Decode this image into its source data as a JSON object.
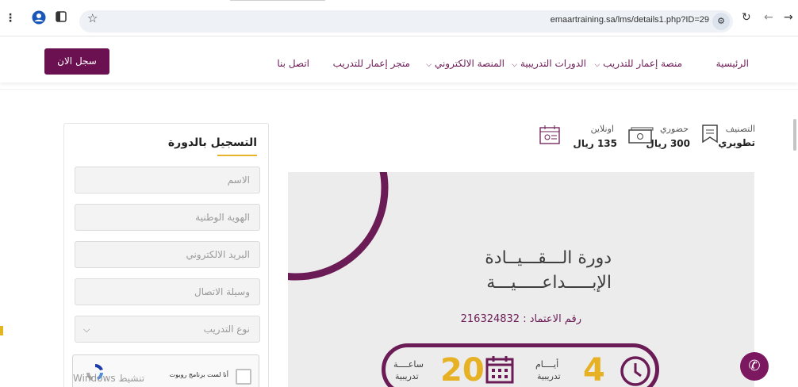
{
  "browser": {
    "url": "emaartraining.sa/lms/details1.php?ID=29",
    "icons": [
      "menu-dots-icon",
      "profile-icon",
      "sidebar-icon",
      "star-icon",
      "tune-icon",
      "reload-icon",
      "back-icon",
      "forward-icon"
    ]
  },
  "header": {
    "register_label": "سجل الان",
    "nav": [
      {
        "label": "الرئيسية"
      },
      {
        "label": "منصة إعمار للتدريب"
      },
      {
        "label": "الدورات التدريبية"
      },
      {
        "label": "المنصة الالكتروني"
      },
      {
        "label": "متجر إعمار للتدريب"
      },
      {
        "label": "اتصل بنا"
      }
    ]
  },
  "course_meta": {
    "category_label": "التصنيف",
    "category_value": "تطويري",
    "attendance_label": "حضوري",
    "attendance_value": "300 ريال",
    "online_label": "اونلاين",
    "online_value": "135 ريال"
  },
  "banner": {
    "title_line1": "دورة الـــقـــيــادة",
    "title_line2": "الإبـــــداعـــــيـــة",
    "accreditation": "رقم الاعتماد : 216324832",
    "days_number": "4",
    "days_word": "أيــــام",
    "days_sub": "تدريبية",
    "hours_number": "20",
    "hours_word": "ساعــــة",
    "hours_sub": "تدريبية",
    "colors": {
      "accent": "#6b1b55",
      "highlight": "#e7b125"
    }
  },
  "form": {
    "title": "التسجيل بالدورة",
    "fields": {
      "name": "الاسم",
      "national_id": "الهوية الوطنية",
      "email": "البريد الالكتروني",
      "contact": "وسيلة الاتصال",
      "training_type": "نوع التدريب"
    },
    "captcha_label": "أنا لست برنامج روبوت"
  },
  "watermark": "Windows تنشيط"
}
